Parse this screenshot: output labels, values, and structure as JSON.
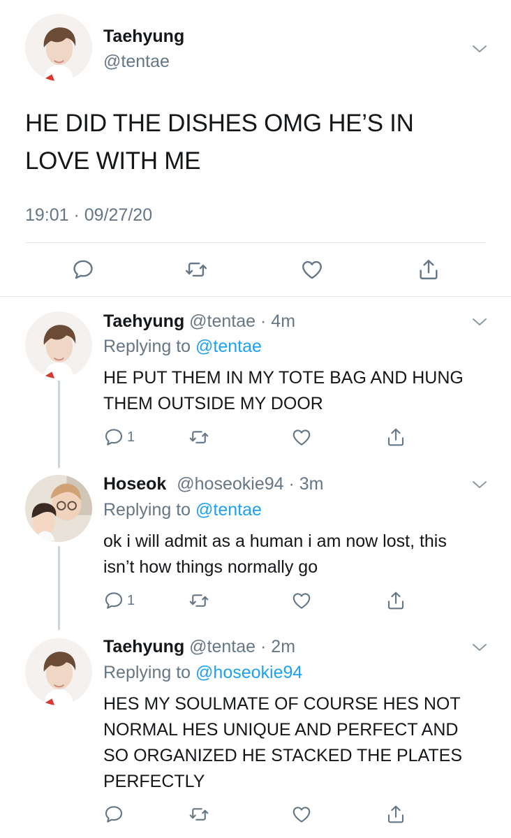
{
  "main_tweet": {
    "name": "Taehyung",
    "handle": "@tentae",
    "text": "HE DID THE DISHES OMG HE’S IN LOVE WITH ME",
    "timestamp": "19:01 · 09/27/20",
    "actions": [
      "reply-icon",
      "retweet-icon",
      "like-icon",
      "share-icon"
    ]
  },
  "replies": [
    {
      "name": "Taehyung",
      "handle": "@tentae",
      "time": "· 4m",
      "replying_prefix": "Replying to",
      "replying_to": "@tentae",
      "text": "HE PUT THEM IN MY TOTE BAG AND HUNG THEM OUTSIDE MY DOOR",
      "reply_count": "1"
    },
    {
      "name": "Hoseok",
      "handle": "@hoseokie94",
      "time": "· 3m",
      "replying_prefix": "Replying to",
      "replying_to": "@tentae",
      "text": "ok i will admit as a human i am now lost, this isn’t how things normally go",
      "reply_count": "1"
    },
    {
      "name": "Taehyung",
      "handle": "@tentae",
      "time": "· 2m",
      "replying_prefix": "Replying to",
      "replying_to": "@hoseokie94",
      "text": "HES MY SOULMATE OF COURSE HES NOT NORMAL HES UNIQUE AND PERFECT AND SO ORGANIZED HE STACKED THE PLATES PERFECTLY",
      "reply_count": ""
    }
  ],
  "colors": {
    "text": "#14171a",
    "secondary": "#657786",
    "link": "#1da1f2",
    "divider": "#e1e8ed",
    "thread_line": "#ccd6dd"
  }
}
